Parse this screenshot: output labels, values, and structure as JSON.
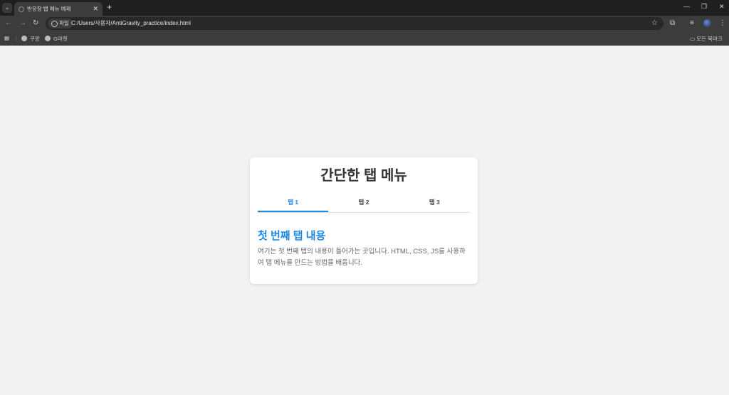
{
  "browser": {
    "tab_title": "반응형 탭 메뉴 예제",
    "new_tab": "+",
    "close": "✕",
    "chip_label": "파일",
    "url": "C:/Users/사용자/AntiGravity_practice/index.html",
    "bookmarks": [
      {
        "label": "쿠팡"
      },
      {
        "label": "G마켓"
      }
    ],
    "all_bookmarks": "모든 북마크"
  },
  "page": {
    "title": "간단한 탭 메뉴",
    "tabs": [
      {
        "label": "탭 1",
        "active": true
      },
      {
        "label": "탭 2"
      },
      {
        "label": "탭 3"
      }
    ],
    "content_heading": "첫 번째 탭 내용",
    "content_text": "여기는 첫 번째 탭의 내용이 들어가는 곳입니다. HTML, CSS, JS를 사용하여 탭 메뉴를 만드는 방법을 배웁니다."
  },
  "colors": {
    "accent": "#1e88e5"
  }
}
